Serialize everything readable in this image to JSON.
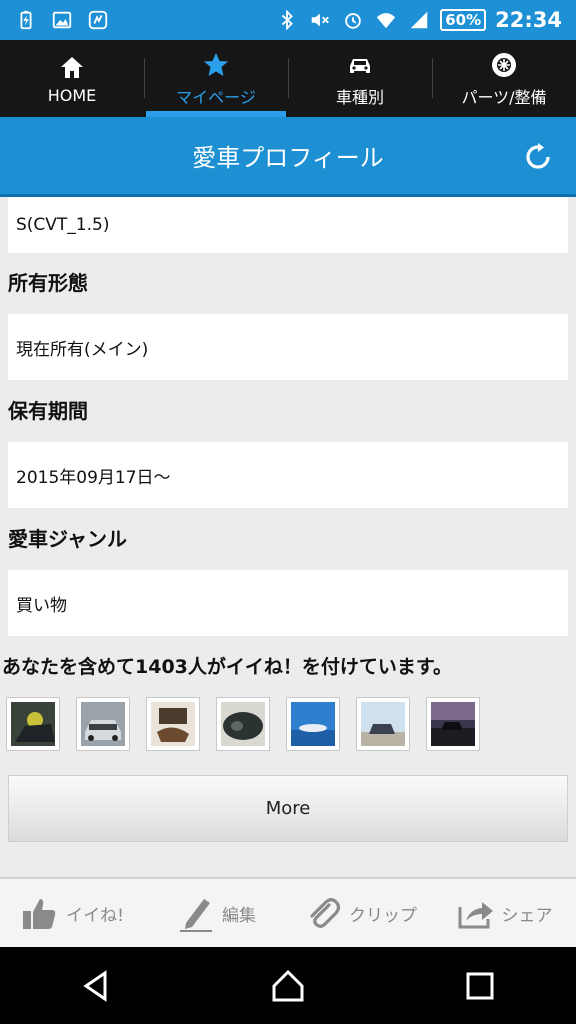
{
  "status_bar": {
    "battery": "60%",
    "time": "22:34"
  },
  "top_nav": {
    "items": [
      {
        "label": "HOME",
        "icon": "home-icon"
      },
      {
        "label": "マイページ",
        "icon": "star-icon"
      },
      {
        "label": "車種別",
        "icon": "car-icon"
      },
      {
        "label": "パーツ/整備",
        "icon": "wheel-icon"
      }
    ],
    "active_index": 1
  },
  "title_bar": {
    "title": "愛車プロフィール"
  },
  "profile": {
    "grade_value": "S(CVT_1.5)",
    "ownership_heading": "所有形態",
    "ownership_value": "現在所有(メイン)",
    "period_heading": "保有期間",
    "period_value": "2015年09月17日〜",
    "genre_heading": "愛車ジャンル",
    "genre_value": "買い物"
  },
  "likes_text": "あなたを含めて1403人がイイね！を付けています。",
  "more_label": "More",
  "actions": [
    {
      "label": "イイね!",
      "icon": "thumbs-up-icon"
    },
    {
      "label": "編集",
      "icon": "pen-icon"
    },
    {
      "label": "クリップ",
      "icon": "paperclip-icon"
    },
    {
      "label": "シェア",
      "icon": "share-icon"
    }
  ],
  "colors": {
    "accent_blue": "#1d8fd3",
    "nav_active": "#2a9ee8",
    "nav_background": "#161616"
  }
}
